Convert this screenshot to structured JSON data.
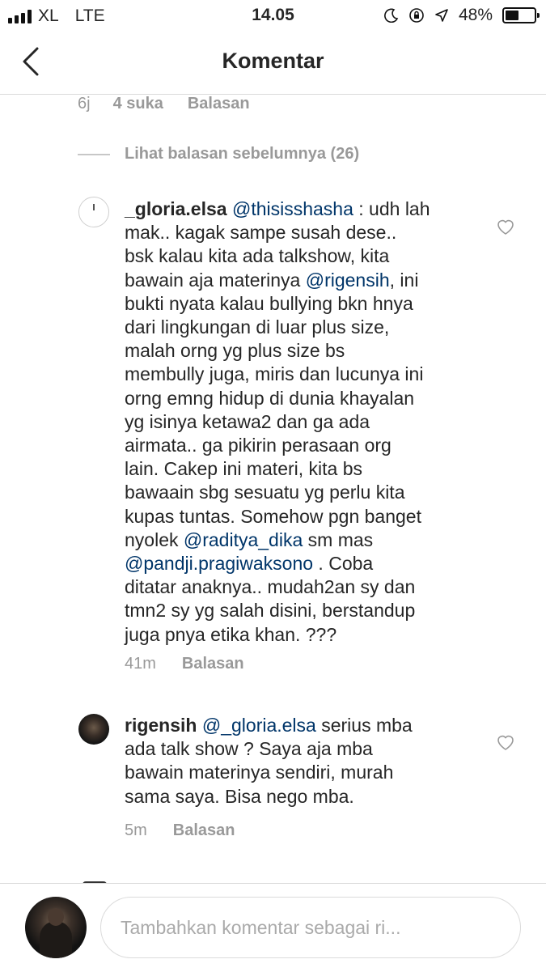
{
  "status_bar": {
    "carrier": "XL",
    "network": "LTE",
    "time": "14.05",
    "battery": "48%",
    "battery_level": 0.48
  },
  "header": {
    "title": "Komentar"
  },
  "prev_meta": {
    "time": "6j",
    "likes": "4 suka",
    "reply": "Balasan"
  },
  "view_previous": "Lihat balasan sebelumnya (26)",
  "comment1": {
    "username": "_gloria.elsa",
    "lines": [
      [
        " ",
        {
          "m": "@thisisshasha"
        },
        " : udh lah"
      ],
      [
        "mak.. kagak sampe susah dese.."
      ],
      [
        "bsk kalau kita ada talkshow, kita"
      ],
      [
        "bawain aja materinya ",
        {
          "m": "@rigensih"
        },
        ", ini"
      ],
      [
        "bukti nyata kalau bullying bkn hnya"
      ],
      [
        "dari lingkungan di luar plus size,"
      ],
      [
        "malah orng yg plus size bs"
      ],
      [
        "membully juga, miris dan lucunya ini"
      ],
      [
        "orng emng hidup di dunia khayalan"
      ],
      [
        "yg isinya ketawa2 dan ga ada"
      ],
      [
        "airmata.. ga pikirin perasaan org"
      ],
      [
        "lain. Cakep ini materi, kita bs"
      ],
      [
        "bawaain sbg sesuatu yg perlu kita"
      ],
      [
        "kupas tuntas. Somehow pgn banget"
      ],
      [
        "nyolek ",
        {
          "m": "@raditya_dika"
        },
        " sm mas"
      ],
      [
        {
          "m": "@pandji.pragiwaksono"
        },
        " . Coba"
      ],
      [
        "ditatar anaknya.. mudah2an sy dan"
      ],
      [
        "tmn2 sy yg salah disini, berstandup"
      ],
      [
        "juga pnya etika khan. ???"
      ]
    ],
    "time": "41m",
    "reply": "Balasan"
  },
  "comment2": {
    "username": "rigensih",
    "lines": [
      [
        " ",
        {
          "m": "@_gloria.elsa"
        },
        " serius mba"
      ],
      [
        "ada talk show ? Saya aja mba"
      ],
      [
        "bawain materinya sendiri, murah"
      ],
      [
        "sama saya. Bisa nego mba."
      ]
    ],
    "time": "5m",
    "reply": "Balasan"
  },
  "composer": {
    "placeholder": "Tambahkan komentar sebagai ri..."
  },
  "colors": {
    "mention": "#003569",
    "muted": "#999999",
    "text": "#262626",
    "divider": "#dbdbdb"
  },
  "icons": [
    "back-arrow-icon",
    "moon-icon",
    "orientation-lock-icon",
    "location-arrow-icon",
    "battery-icon",
    "heart-icon"
  ]
}
